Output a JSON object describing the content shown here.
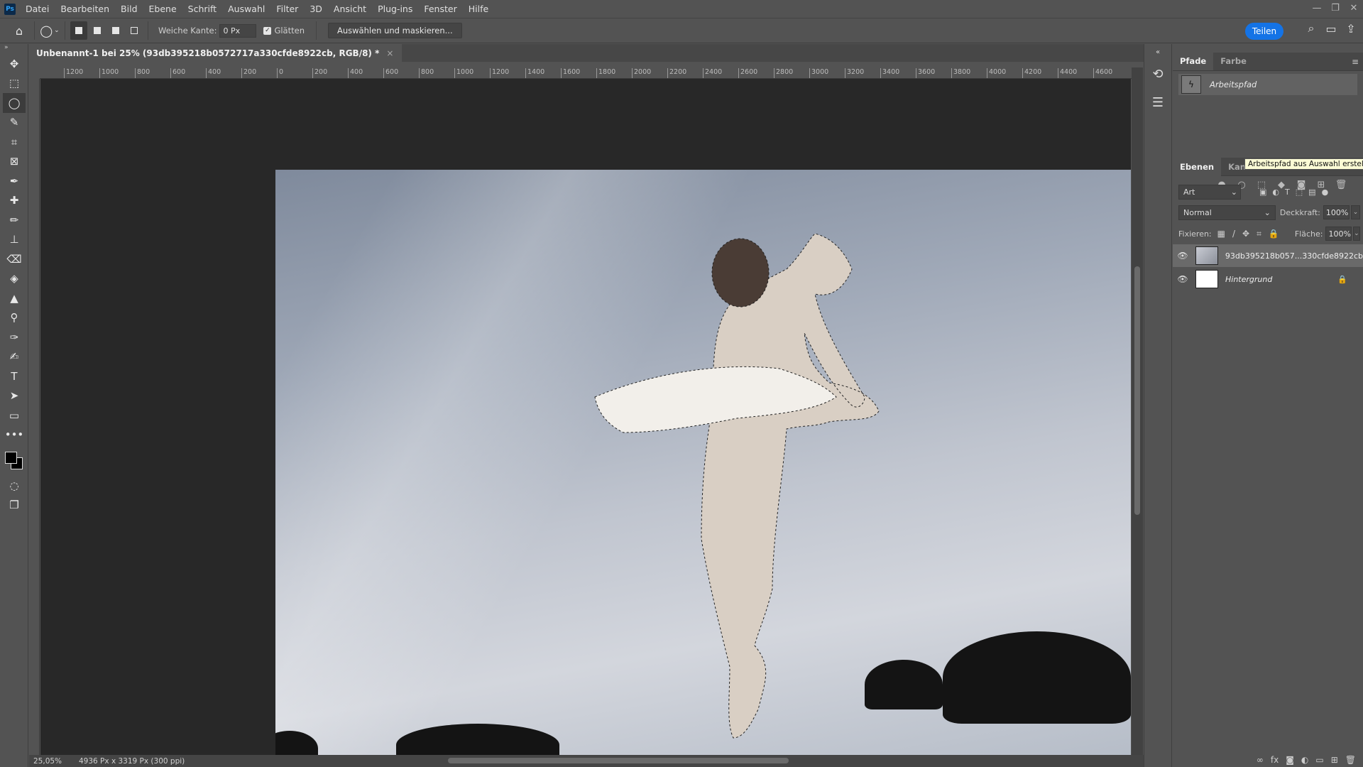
{
  "app": {
    "logo": "Ps"
  },
  "menu": [
    "Datei",
    "Bearbeiten",
    "Bild",
    "Ebene",
    "Schrift",
    "Auswahl",
    "Filter",
    "3D",
    "Ansicht",
    "Plug-ins",
    "Fenster",
    "Hilfe"
  ],
  "window_controls": {
    "minimize": "—",
    "restore": "❐",
    "close": "✕"
  },
  "options": {
    "feather_label": "Weiche Kante:",
    "feather_value": "0 Px",
    "antialias_label": "Glätten",
    "antialias_checked": true,
    "select_mask_label": "Auswählen und maskieren...",
    "share_label": "Teilen"
  },
  "document": {
    "tab_title": "Unbenannt-1 bei 25% (93db395218b0572717a330cfde8922cb, RGB/8) *",
    "close": "×",
    "ruler_h": [
      "1200",
      "1000",
      "800",
      "600",
      "400",
      "200",
      "0",
      "200",
      "400",
      "600",
      "800",
      "1000",
      "1200",
      "1400",
      "1600",
      "1800",
      "2000",
      "2200",
      "2400",
      "2600",
      "2800",
      "3000",
      "3200",
      "3400",
      "3600",
      "3800",
      "4000",
      "4200",
      "4400",
      "4600"
    ],
    "zoom": "25,05%",
    "info": "4936 Px x 3319 Px (300 ppi)"
  },
  "tools": [
    "move",
    "marquee",
    "lasso",
    "quick-select",
    "crop",
    "frame",
    "eyedropper",
    "healing",
    "brush",
    "stamp",
    "eraser",
    "paint-bucket",
    "sharpen",
    "dodge",
    "pen",
    "freeform-pen",
    "type",
    "path-select",
    "rectangle",
    "more"
  ],
  "paths_panel": {
    "tabs": [
      "Pfade",
      "Farbe"
    ],
    "active_tab": "Pfade",
    "items": [
      {
        "name": "Arbeitspfad"
      }
    ],
    "tooltip": "Arbeitspfad aus Auswahl erstellen"
  },
  "layers_panel": {
    "tabs": [
      "Ebenen",
      "Kanäle"
    ],
    "active_tab": "Ebenen",
    "filter": "Art",
    "blend_mode": "Normal",
    "opacity_label": "Deckkraft:",
    "opacity": "100%",
    "lock_label": "Fixieren:",
    "fill_label": "Fläche:",
    "fill": "100%",
    "layers": [
      {
        "name": "93db395218b057...330cfde8922cb",
        "selected": true,
        "visible": true
      },
      {
        "name": "Hintergrund",
        "selected": false,
        "visible": true,
        "locked": true
      }
    ]
  },
  "colors": {
    "accent": "#1473e6",
    "foreground": "#000000",
    "background": "#000000"
  }
}
